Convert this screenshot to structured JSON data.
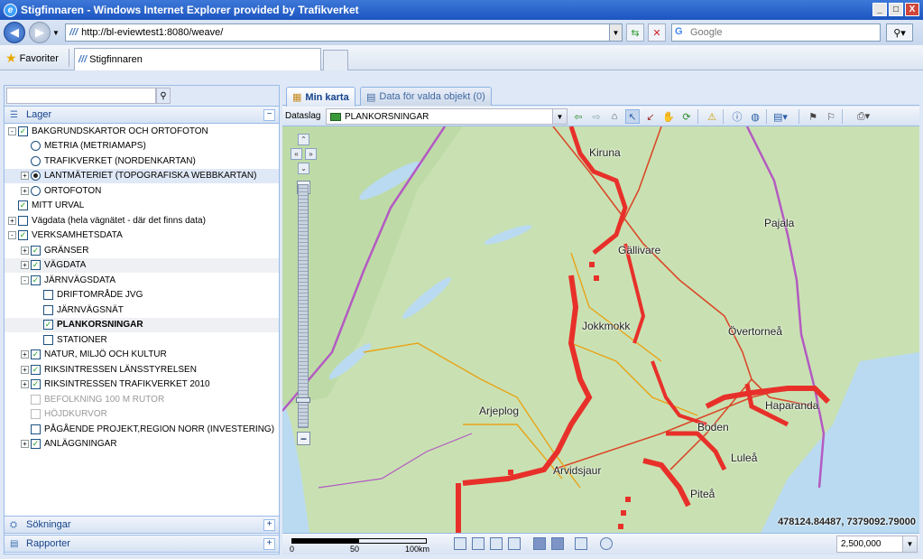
{
  "window": {
    "title": "Stigfinnaren - Windows Internet Explorer provided by Trafikverket",
    "buttons": {
      "minimize": "_",
      "maximize": "□",
      "close": "X"
    }
  },
  "addressbar": {
    "url": "http://bl-eviewtest1:8080/weave/",
    "search_placeholder": "Google"
  },
  "favbar": {
    "favorites_label": "Favoriter",
    "tab_title": "Stigfinnaren"
  },
  "left": {
    "search_value": "",
    "layers_title": "Lager",
    "tree": [
      {
        "label": "BAKGRUNDSKARTOR OCH ORTOFOTON",
        "level": 0,
        "exp": "-",
        "kind": "cb",
        "checked": true
      },
      {
        "label": "METRIA (METRIAMAPS)",
        "level": 1,
        "exp": "",
        "kind": "rb",
        "checked": false
      },
      {
        "label": "TRAFIKVERKET (NORDENKARTAN)",
        "level": 1,
        "exp": "",
        "kind": "rb",
        "checked": false
      },
      {
        "label": "LANTMÄTERIET (TOPOGRAFISKA WEBBKARTAN)",
        "level": 1,
        "exp": "+",
        "kind": "rb",
        "checked": true,
        "selected": true
      },
      {
        "label": "ORTOFOTON",
        "level": 1,
        "exp": "+",
        "kind": "rb",
        "checked": false
      },
      {
        "label": "MITT URVAL",
        "level": 0,
        "exp": "",
        "kind": "cb",
        "checked": true
      },
      {
        "label": "Vägdata (hela vägnätet - där det finns data)",
        "level": 0,
        "exp": "+",
        "kind": "cb",
        "checked": false,
        "case": "normal"
      },
      {
        "label": "VERKSAMHETSDATA",
        "level": 0,
        "exp": "-",
        "kind": "cb",
        "checked": true
      },
      {
        "label": "GRÄNSER",
        "level": 1,
        "exp": "+",
        "kind": "cb",
        "checked": true
      },
      {
        "label": "VÄGDATA",
        "level": 1,
        "exp": "+",
        "kind": "cb",
        "checked": true,
        "alt": true
      },
      {
        "label": "JÄRNVÄGSDATA",
        "level": 1,
        "exp": "-",
        "kind": "cb",
        "checked": true
      },
      {
        "label": "DRIFTOMRÅDE JVG",
        "level": 2,
        "exp": "",
        "kind": "cb",
        "checked": false
      },
      {
        "label": "JÄRNVÄGSNÄT",
        "level": 2,
        "exp": "",
        "kind": "cb",
        "checked": false
      },
      {
        "label": "PLANKORSNINGAR",
        "level": 2,
        "exp": "",
        "kind": "cb",
        "checked": true,
        "bold": true,
        "alt": true
      },
      {
        "label": "STATIONER",
        "level": 2,
        "exp": "",
        "kind": "cb",
        "checked": false
      },
      {
        "label": "NATUR, MILJÖ OCH KULTUR",
        "level": 1,
        "exp": "+",
        "kind": "cb",
        "checked": true
      },
      {
        "label": "RIKSINTRESSEN LÄNSSTYRELSEN",
        "level": 1,
        "exp": "+",
        "kind": "cb",
        "checked": true
      },
      {
        "label": "RIKSINTRESSEN TRAFIKVERKET 2010",
        "level": 1,
        "exp": "+",
        "kind": "cb",
        "checked": true
      },
      {
        "label": "BEFOLKNING 100 M RUTOR",
        "level": 1,
        "exp": "",
        "kind": "cb",
        "checked": false,
        "disabled": true
      },
      {
        "label": "HÖJDKURVOR",
        "level": 1,
        "exp": "",
        "kind": "cb",
        "checked": false,
        "disabled": true
      },
      {
        "label": "PÅGÅENDE PROJEKT,REGION NORR (INVESTERING)",
        "level": 1,
        "exp": "",
        "kind": "cb",
        "checked": false
      },
      {
        "label": "ANLÄGGNINGAR",
        "level": 1,
        "exp": "+",
        "kind": "cb",
        "checked": true
      }
    ],
    "searches_title": "Sökningar",
    "reports_title": "Rapporter"
  },
  "right": {
    "tab_map": "Min karta",
    "tab_data": "Data för valda objekt (0)",
    "dataslag_label": "Dataslag",
    "dataslag_value": "PLANKORSNINGAR",
    "coordinates": "478124.84487, 7379092.79000",
    "scale_value": "2,500,000",
    "scale_labels": [
      "0",
      "50",
      "100km"
    ],
    "places": [
      "Kiruna",
      "Pajala",
      "Gällivare",
      "Jokkmokk",
      "Övertorneå",
      "Arjeplog",
      "Haparanda",
      "Boden",
      "Luleå",
      "Arvidsjaur",
      "Piteå"
    ]
  },
  "colors": {
    "accent": "#15428b",
    "crossings": "#e8302a",
    "border_line": "#b35ac2",
    "road_main": "#d94a2a",
    "road_secondary": "#e8a317",
    "sea": "#b9daf0"
  }
}
